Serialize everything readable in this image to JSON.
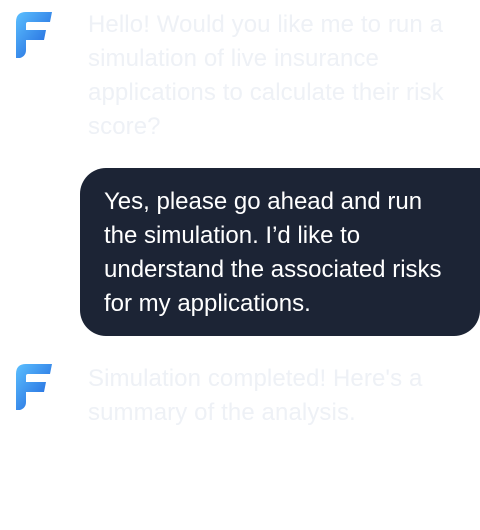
{
  "messages": [
    {
      "role": "assistant",
      "avatar_icon": "brand-f-logo-icon",
      "text": "Hello! Would you like me to run a simulation of live insurance applications to calculate their risk score?"
    },
    {
      "role": "user",
      "text": "Yes, please go ahead and run the simulation. I’d like to understand the associated risks for my applications."
    },
    {
      "role": "assistant",
      "avatar_icon": "brand-f-logo-icon",
      "text": "Simulation completed! Here's a summary of the analysis."
    }
  ],
  "colors": {
    "user_bubble": "#1c2435",
    "user_text": "#ffffff",
    "assistant_text": "#eef1f6",
    "logo_gradient_start": "#3fa8ff",
    "logo_gradient_end": "#1a5cd8"
  }
}
